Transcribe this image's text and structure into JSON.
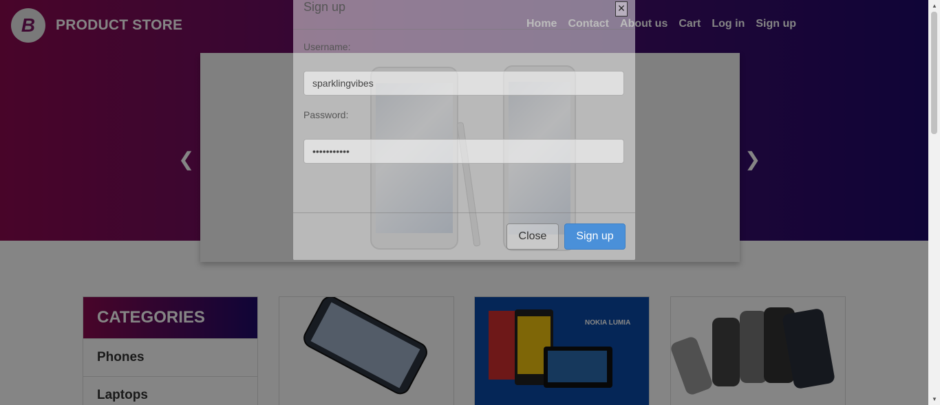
{
  "brand": {
    "logo_letter": "B",
    "name": "PRODUCT STORE"
  },
  "nav": {
    "items": [
      "Home",
      "Contact",
      "About us",
      "Cart",
      "Log in",
      "Sign up"
    ]
  },
  "carousel": {
    "prev_icon": "chevron-left-icon",
    "next_icon": "chevron-right-icon"
  },
  "categories": {
    "title": "CATEGORIES",
    "items": [
      "Phones",
      "Laptops"
    ]
  },
  "modal": {
    "title": "Sign up",
    "close_x": "×",
    "username_label": "Username:",
    "username_value": "sparklingvibes",
    "password_label": "Password:",
    "password_value": "•••••••••••",
    "close_button": "Close",
    "submit_button": "Sign up"
  },
  "products": {
    "card2_banner_text": "NOKIA LUMIA"
  },
  "colors": {
    "accent": "#4a90d9",
    "hero_start": "#8b0a50",
    "hero_end": "#1f0a6a"
  }
}
